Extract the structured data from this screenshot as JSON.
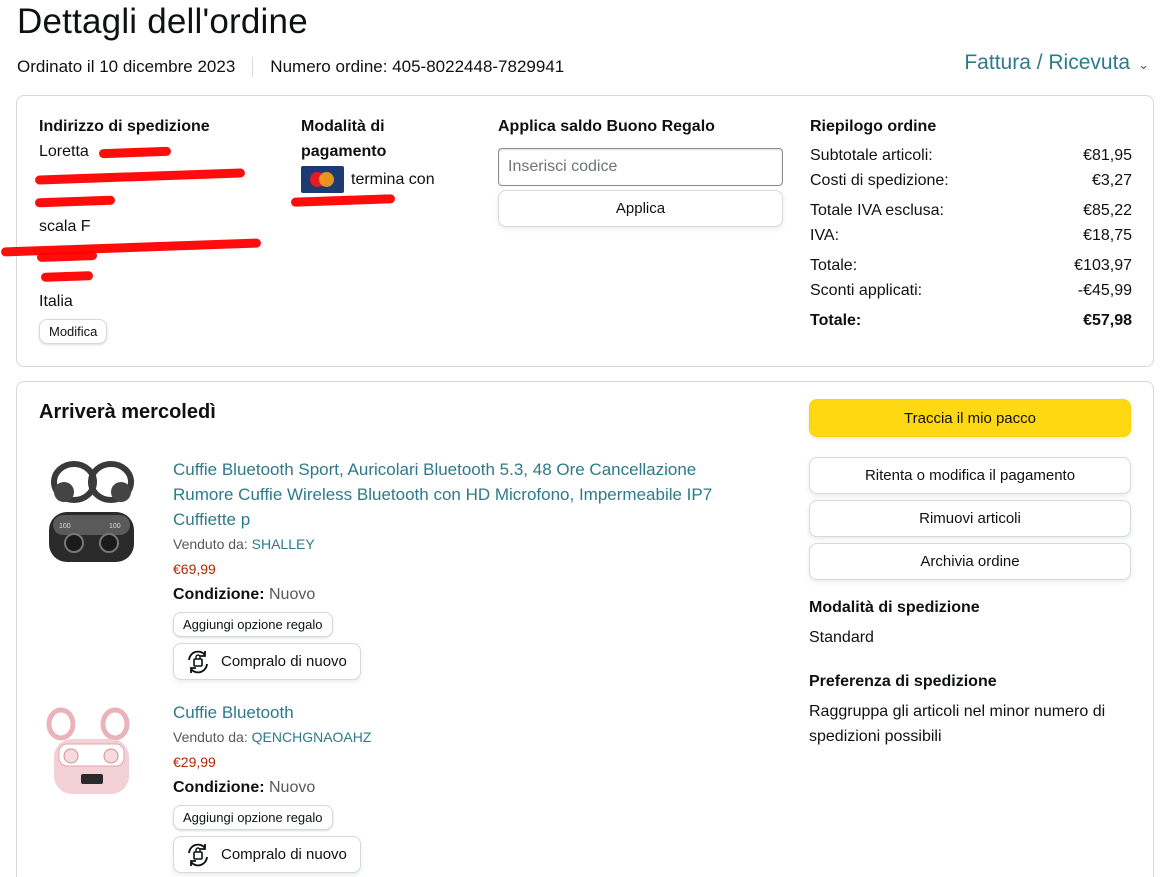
{
  "header": {
    "title": "Dettagli dell'ordine",
    "order_date": "Ordinato il 10 dicembre 2023",
    "order_number": "Numero ordine: 405-8022448-7829941",
    "invoice_link": "Fattura / Ricevuta"
  },
  "shipping_address": {
    "title": "Indirizzo di spedizione",
    "name_partial": "Loretta",
    "line_scala": "scala F",
    "country": "Italia",
    "edit_label": "Modifica"
  },
  "payment": {
    "title": "Modalità di pagamento",
    "card_text": "termina con"
  },
  "gift_card": {
    "title": "Applica saldo Buono Regalo",
    "placeholder": "Inserisci codice",
    "apply_label": "Applica"
  },
  "summary": {
    "title": "Riepilogo ordine",
    "rows": [
      {
        "label": "Subtotale articoli:",
        "value": "€81,95"
      },
      {
        "label": "Costi di spedizione:",
        "value": "€3,27"
      },
      {
        "label": "Totale IVA esclusa:",
        "value": "€85,22"
      },
      {
        "label": "IVA:",
        "value": "€18,75"
      },
      {
        "label": "Totale:",
        "value": "€103,97"
      },
      {
        "label": "Sconti applicati:",
        "value": "-€45,99"
      },
      {
        "label": "Totale:",
        "value": "€57,98"
      }
    ]
  },
  "shipment": {
    "arrival": "Arriverà mercoledì",
    "items": [
      {
        "title": "Cuffie Bluetooth Sport, Auricolari Bluetooth 5.3, 48 Ore Cancellazione Rumore Cuffie Wireless Bluetooth con HD Microfono, Impermeabile IP7 Cuffiette p",
        "sold_by_label": "Venduto da: ",
        "seller": "SHALLEY",
        "price": "€69,99",
        "condition_label": "Condizione:",
        "condition_value": " Nuovo",
        "gift_option": "Aggiungi opzione regalo",
        "rebuy": "Compralo di nuovo"
      },
      {
        "title": "Cuffie Bluetooth",
        "sold_by_label": "Venduto da: ",
        "seller": "QENCHGNAOAHZ",
        "price": "€29,99",
        "condition_label": "Condizione:",
        "condition_value": " Nuovo",
        "gift_option": "Aggiungi opzione regalo",
        "rebuy": "Compralo di nuovo"
      }
    ],
    "actions": {
      "track": "Traccia il mio pacco",
      "retry_payment": "Ritenta o modifica il pagamento",
      "remove_items": "Rimuovi articoli",
      "archive": "Archivia ordine"
    },
    "shipping_mode_title": "Modalità di spedizione",
    "shipping_mode_value": "Standard",
    "shipping_pref_title": "Preferenza di spedizione",
    "shipping_pref_value": "Raggruppa gli articoli nel minor numero di spedizioni possibili"
  },
  "colors": {
    "link": "#2d7a8a",
    "price": "#b12704",
    "primary_button": "#ffd814",
    "redaction": "#ff0000"
  },
  "icons": [
    "chevron-down-icon",
    "mastercard-icon",
    "rebuy-icon"
  ]
}
